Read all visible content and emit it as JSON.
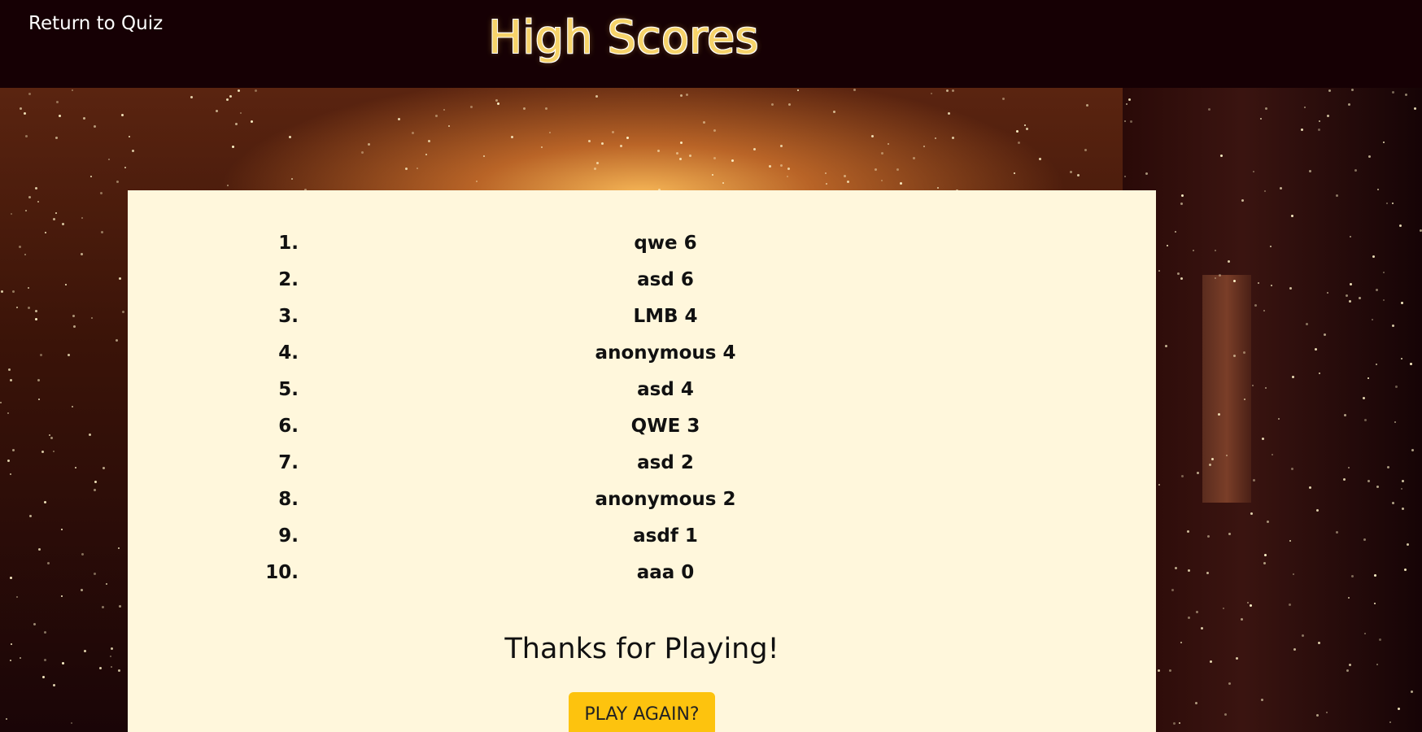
{
  "header": {
    "return_link": "Return to Quiz",
    "title": "High Scores"
  },
  "scores": [
    {
      "rank": "1.",
      "entry": "qwe 6"
    },
    {
      "rank": "2.",
      "entry": "asd 6"
    },
    {
      "rank": "3.",
      "entry": "LMB 4"
    },
    {
      "rank": "4.",
      "entry": "anonymous 4"
    },
    {
      "rank": "5.",
      "entry": "asd 4"
    },
    {
      "rank": "6.",
      "entry": "QWE 3"
    },
    {
      "rank": "7.",
      "entry": "asd 2"
    },
    {
      "rank": "8.",
      "entry": "anonymous 2"
    },
    {
      "rank": "9.",
      "entry": "asdf 1"
    },
    {
      "rank": "10.",
      "entry": "aaa 0"
    }
  ],
  "footer": {
    "thanks": "Thanks for Playing!",
    "play_again": "PLAY AGAIN?"
  },
  "colors": {
    "header_bg": "#160004",
    "title": "#f6d36a",
    "card_bg": "#fff7dc",
    "button": "#fdc30e"
  }
}
